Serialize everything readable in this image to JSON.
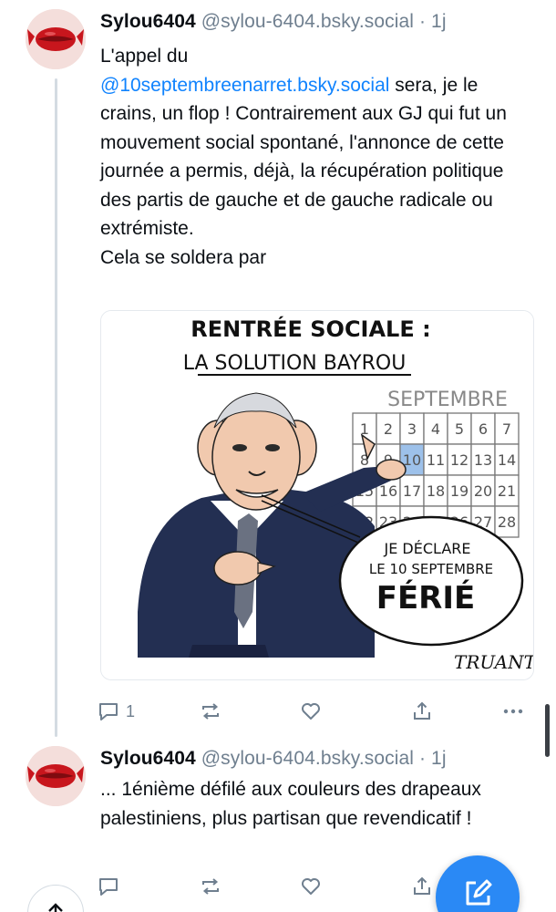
{
  "colors": {
    "accent": "#1083fe",
    "secondary_text": "#6f7f8f",
    "thread_line": "#d4dbe2",
    "fab": "#2a89f5"
  },
  "posts": [
    {
      "display_name": "Sylou6404",
      "handle": "@sylou-6404.bsky.social",
      "separator": "·",
      "age": "1j",
      "text_before_mention": "L'appel du",
      "mention": "@10septembreenarret.bsky.social",
      "text_after_mention": " sera, je le crains, un flop ! Contrairement aux GJ qui fut un mouvement social spontané, l'annonce de cette journée a permis, déjà, la récupération politique des partis de gauche et de gauche radicale ou extrémiste.",
      "text_last_line": "Cela se soldera par",
      "media": {
        "title_line_1": "RENTRÉE SOCIALE :",
        "title_line_2": "LA SOLUTION BAYROU",
        "calendar_month": "SEPTEMBRE",
        "calendar_days": [
          "1",
          "2",
          "3",
          "4",
          "5",
          "6",
          "7",
          "8",
          "9",
          "10",
          "11",
          "12",
          "13",
          "14",
          "15",
          "16",
          "17",
          "18",
          "19",
          "20",
          "21",
          "22",
          "23",
          "24",
          "25",
          "26",
          "27",
          "28"
        ],
        "highlighted_day": "10",
        "bubble_line_1": "JE DÉCLARE",
        "bubble_line_2": "LE 10 SEPTEMBRE",
        "bubble_line_3": "FÉRIÉ",
        "signature": "TRUANT"
      },
      "reply_count": "1",
      "icons": [
        "reply-icon",
        "repost-icon",
        "like-icon",
        "share-icon",
        "more-icon"
      ]
    },
    {
      "display_name": "Sylou6404",
      "handle": "@sylou-6404.bsky.social",
      "separator": "·",
      "age": "1j",
      "text": "... 1énième défilé aux couleurs des drapeaux palestiniens, plus partisan que revendicatif !",
      "icons": [
        "reply-icon",
        "repost-icon",
        "like-icon",
        "share-icon"
      ]
    }
  ],
  "fab_icon": "compose-icon",
  "scroll_top_icon": "arrow-up-icon"
}
